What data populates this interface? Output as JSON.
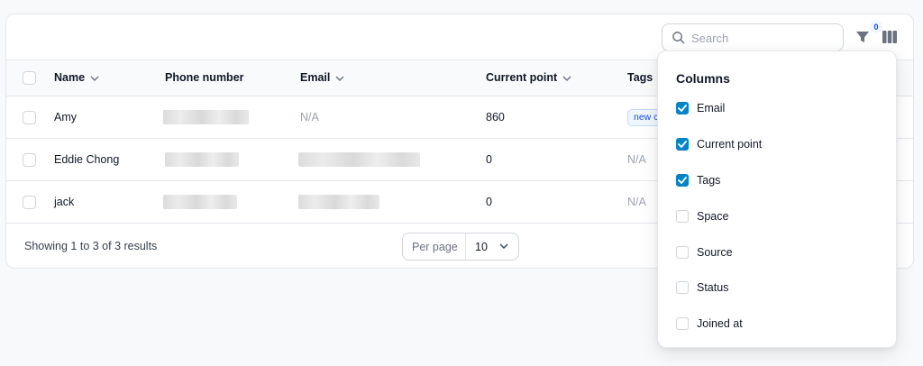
{
  "colors": {
    "accent": "#0284c7",
    "tag_bg": "#eff6ff",
    "tag_text": "#1d4ed8"
  },
  "toolbar": {
    "search_placeholder": "Search",
    "filter_count": "0"
  },
  "table": {
    "headers": {
      "name": "Name",
      "phone": "Phone number",
      "email": "Email",
      "current_point": "Current point",
      "tags": "Tags"
    },
    "rows": [
      {
        "name": "Amy",
        "email": "N/A",
        "point": "860",
        "tag": "new c"
      },
      {
        "name": "Eddie Chong",
        "point": "0",
        "tags": "N/A"
      },
      {
        "name": "jack",
        "point": "0",
        "tags": "N/A"
      }
    ]
  },
  "footer": {
    "results": "Showing 1 to 3 of 3 results",
    "per_page_label": "Per page",
    "per_page_value": "10"
  },
  "columns_menu": {
    "title": "Columns",
    "options": [
      {
        "label": "Email",
        "checked": true
      },
      {
        "label": "Current point",
        "checked": true
      },
      {
        "label": "Tags",
        "checked": true
      },
      {
        "label": "Space",
        "checked": false
      },
      {
        "label": "Source",
        "checked": false
      },
      {
        "label": "Status",
        "checked": false
      },
      {
        "label": "Joined at",
        "checked": false
      }
    ]
  }
}
